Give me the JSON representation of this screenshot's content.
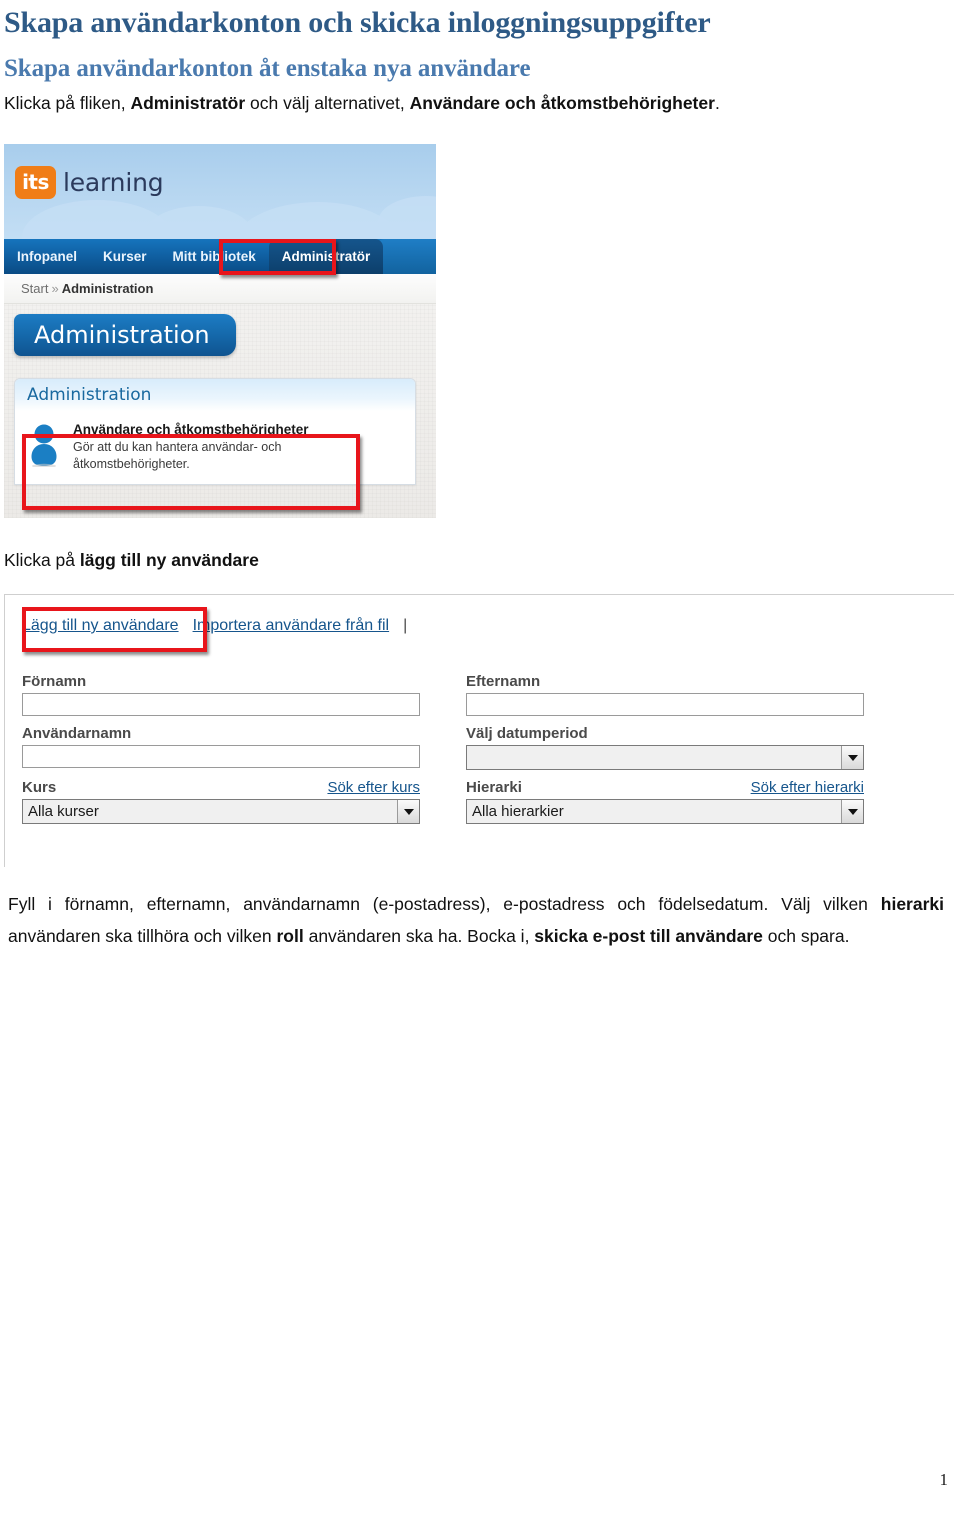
{
  "document": {
    "title": "Skapa användarkonton och skicka inloggningsuppgifter",
    "subtitle": "Skapa användarkonton åt enstaka nya användare",
    "page_number": "1"
  },
  "intro": {
    "part1": "Klicka på fliken, ",
    "bold1": "Administratör",
    "part2": " och välj alternativet, ",
    "bold2": "Användare och åtkomstbehörigheter",
    "part3": "."
  },
  "caption_step2": {
    "part1": "Klicka på ",
    "bold1": "lägg till ny användare"
  },
  "screenshot_admin": {
    "logo": {
      "mark": "its",
      "word": "learning"
    },
    "nav": [
      {
        "label": "Infopanel",
        "active": false
      },
      {
        "label": "Kurser",
        "active": false
      },
      {
        "label": "Mitt bibliotek",
        "active": false
      },
      {
        "label": "Administratör",
        "active": true
      }
    ],
    "breadcrumb": {
      "root": "Start",
      "separator": "»",
      "current": "Administration"
    },
    "page_tab": "Administration",
    "panel": {
      "header": "Administration",
      "item_title": "Användare och åtkomstbehörigheter",
      "item_desc_line1": "Gör att du kan hantera användar- och",
      "item_desc_line2": "åtkomstbehörigheter."
    }
  },
  "screenshot_form": {
    "tabs": {
      "add_user": "Lägg till ny användare",
      "import_user": "Importera användare från fil",
      "pipe": "|"
    },
    "fields": {
      "first_name": {
        "label": "Förnamn",
        "value": ""
      },
      "last_name": {
        "label": "Efternamn",
        "value": ""
      },
      "username": {
        "label": "Användarnamn",
        "value": ""
      },
      "date_period": {
        "label": "Välj datumperiod",
        "value": ""
      },
      "course": {
        "label": "Kurs",
        "link": "Sök efter kurs",
        "value": "Alla kurser"
      },
      "hierarchy": {
        "label": "Hierarki",
        "link": "Sök efter hierarki",
        "value": "Alla hierarkier"
      }
    }
  },
  "closing": {
    "part1": "Fyll i förnamn, efternamn, användarnamn (e-postadress), e-postadress och födelsedatum. Välj vilken ",
    "bold1": "hierarki",
    "part2": " användaren ska tillhöra och vilken ",
    "bold2": "roll",
    "part3": " användaren ska ha. Bocka i, ",
    "bold3": "skicka e-post till användare",
    "part4": " och spara."
  },
  "colors": {
    "h1": "#2e5a86",
    "h2": "#4a7aae",
    "annotation": "#e8151b",
    "brand_orange": "#f07d17",
    "brand_blue": "#0f5d9e",
    "link": "#16558c"
  }
}
